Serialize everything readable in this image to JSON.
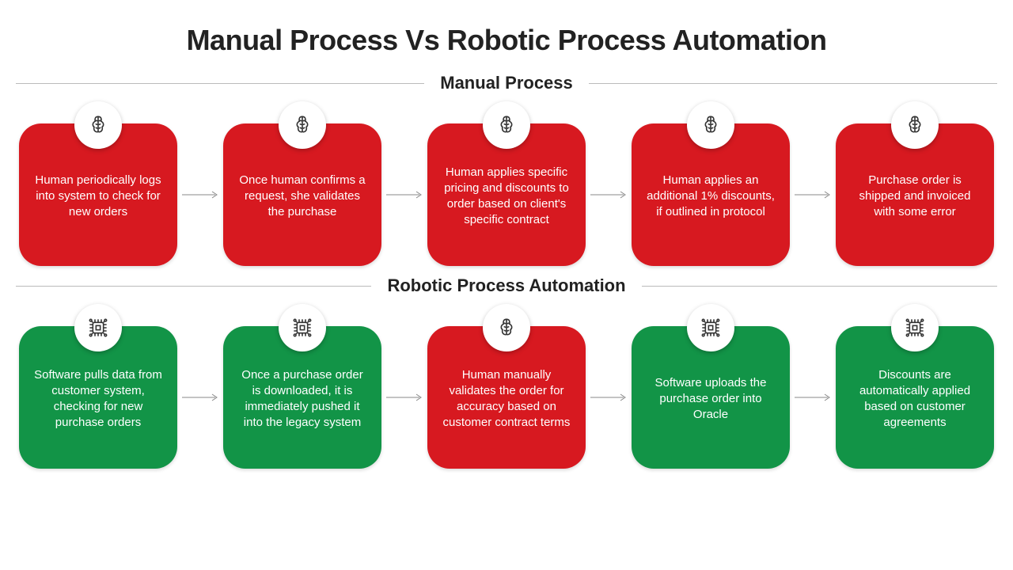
{
  "title": "Manual Process Vs Robotic Process Automation",
  "sections": {
    "manual": {
      "heading": "Manual Process",
      "cards": [
        {
          "text": "Human periodically logs into system to check for new orders",
          "color": "red",
          "icon": "brain"
        },
        {
          "text": "Once human confirms a request, she validates the purchase",
          "color": "red",
          "icon": "brain"
        },
        {
          "text": "Human applies specific pricing and discounts to order based on client's specific contract",
          "color": "red",
          "icon": "brain"
        },
        {
          "text": "Human applies an additional 1% discounts, if outlined in protocol",
          "color": "red",
          "icon": "brain"
        },
        {
          "text": "Purchase order is shipped and invoiced with some error",
          "color": "red",
          "icon": "brain"
        }
      ]
    },
    "rpa": {
      "heading": "Robotic Process Automation",
      "cards": [
        {
          "text": "Software pulls data from customer system, checking for new purchase orders",
          "color": "green",
          "icon": "chip"
        },
        {
          "text": "Once a purchase order is downloaded, it is immediately pushed it into the legacy system",
          "color": "green",
          "icon": "chip"
        },
        {
          "text": "Human manually validates the order for accuracy based on customer contract terms",
          "color": "red",
          "icon": "brain"
        },
        {
          "text": "Software uploads the purchase order into Oracle",
          "color": "green",
          "icon": "chip"
        },
        {
          "text": "Discounts are automatically applied based on customer agreements",
          "color": "green",
          "icon": "chip"
        }
      ]
    }
  },
  "colors": {
    "red": "#D71920",
    "green": "#129447"
  }
}
